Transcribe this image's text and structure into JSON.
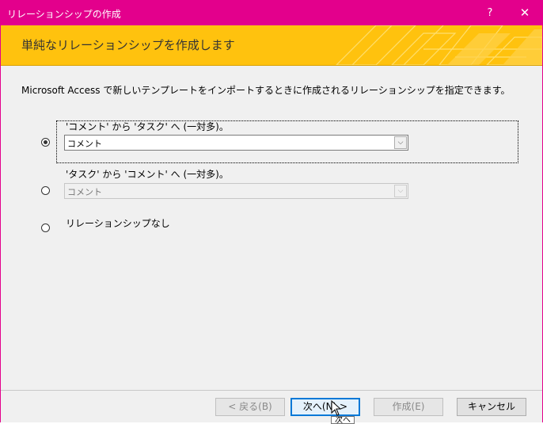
{
  "window": {
    "title": "リレーションシップの作成",
    "help": "?",
    "close": "✕"
  },
  "banner": {
    "title": "単純なリレーションシップを作成します"
  },
  "description": "Microsoft Access で新しいテンプレートをインポートするときに作成されるリレーションシップを指定できます。",
  "options": [
    {
      "label": "'コメント' から 'タスク' へ (一対多)。",
      "combo_value": "コメント",
      "selected": true,
      "enabled": true
    },
    {
      "label": "'タスク' から 'コメント' へ (一対多)。",
      "combo_value": "コメント",
      "selected": false,
      "enabled": false
    },
    {
      "label": "リレーションシップなし",
      "selected": false
    }
  ],
  "buttons": {
    "back": "< 戻る(B)",
    "next": "次へ(N) >",
    "finish": "作成(E)",
    "cancel": "キャンセル"
  },
  "tooltip": "次へ",
  "colors": {
    "titlebar": "#e3008c",
    "banner": "#ffc20e",
    "focus_blue": "#0078d7"
  },
  "icons": {
    "combo_arrow": "chevron-down-icon",
    "cursor": "arrow-cursor-icon"
  }
}
